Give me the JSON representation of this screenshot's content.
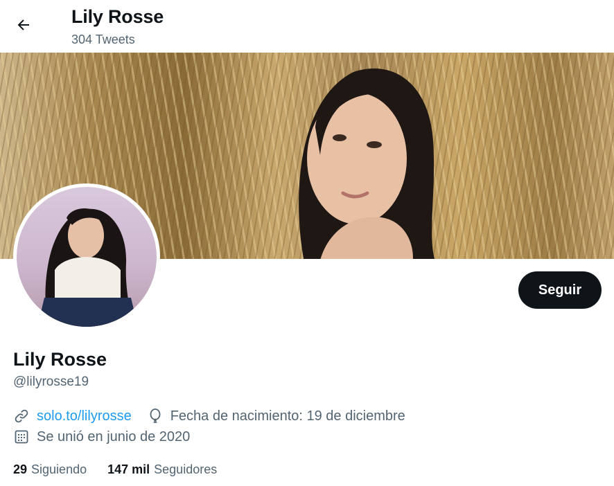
{
  "header": {
    "title": "Lily Rosse",
    "tweet_count": "304 Tweets",
    "back_icon": "arrow-left-icon"
  },
  "profile": {
    "name": "Lily Rosse",
    "handle": "@lilyrosse19",
    "follow_label": "Seguir",
    "link": "solo.to/lilyrosse",
    "birthday": "Fecha de nacimiento: 19 de diciembre",
    "joined": "Se unió en junio de 2020"
  },
  "stats": {
    "following_count": "29",
    "following_label": "Siguiendo",
    "followers_count": "147 mil",
    "followers_label": "Seguidores"
  },
  "colors": {
    "accent": "#1d9bf0",
    "text": "#0f1419",
    "secondary": "#536471",
    "button_bg": "#0f1419"
  }
}
